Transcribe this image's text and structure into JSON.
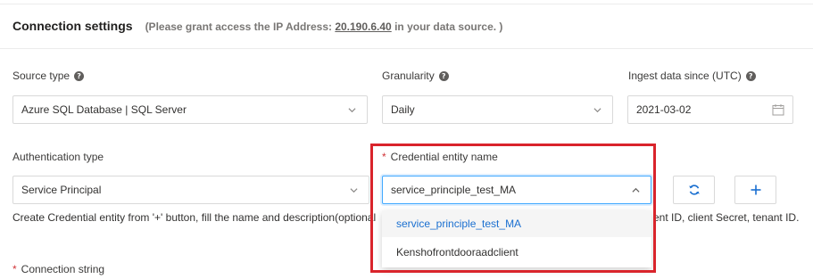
{
  "header": {
    "title": "Connection settings",
    "note_prefix": "(Please grant access the IP Address: ",
    "ip_address": "20.190.6.40",
    "note_suffix": " in your data source. )"
  },
  "source_type": {
    "label": "Source type",
    "value": "Azure SQL Database | SQL Server"
  },
  "granularity": {
    "label": "Granularity",
    "value": "Daily"
  },
  "ingest": {
    "label": "Ingest data since (UTC)",
    "value": "2021-03-02"
  },
  "auth_type": {
    "label": "Authentication type",
    "value": "Service Principal"
  },
  "credential": {
    "required_mark": "*",
    "label": "Credential entity name",
    "value": "service_principle_test_MA",
    "options": [
      "service_principle_test_MA",
      "Kenshofrontdooraadclient"
    ]
  },
  "help_text": {
    "start": "Create Credential entity from '+' button, fill the name and description(optional",
    "end": "ent ID, client Secret, tenant ID."
  },
  "connection_string": {
    "required_mark": "*",
    "label": "Connection string"
  },
  "icons": {
    "refresh": "refresh-icon",
    "add": "plus-icon",
    "help": "question-circle-icon",
    "calendar": "calendar-icon"
  },
  "colors": {
    "accent": "#1a6fd0",
    "highlight_box": "#d9242b",
    "required": "#d13438"
  }
}
